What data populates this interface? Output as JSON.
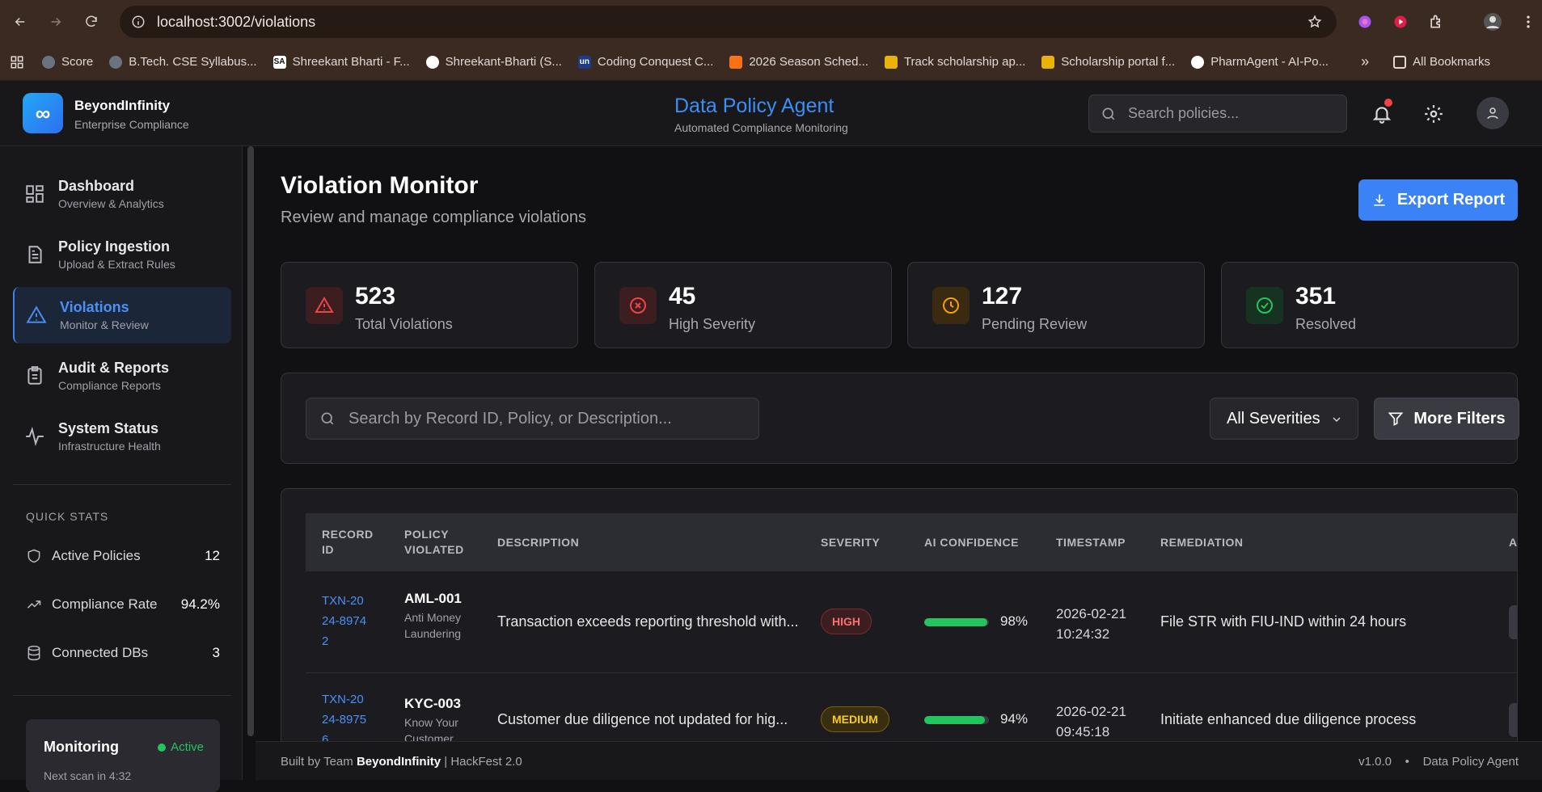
{
  "browser": {
    "url": "localhost:3002/violations",
    "bookmarks": [
      {
        "label": "Score",
        "icon": "globe-icon"
      },
      {
        "label": "B.Tech. CSE Syllabus...",
        "icon": "globe-icon"
      },
      {
        "label": "Shreekant Bharti - F...",
        "icon": "sa-icon"
      },
      {
        "label": "Shreekant-Bharti (S...",
        "icon": "github-icon"
      },
      {
        "label": "Coding Conquest C...",
        "icon": "un-icon"
      },
      {
        "label": "2026 Season Sched...",
        "icon": "ticket-icon"
      },
      {
        "label": "Track scholarship ap...",
        "icon": "scholar-icon"
      },
      {
        "label": "Scholarship portal f...",
        "icon": "scholar-icon"
      },
      {
        "label": "PharmAgent - AI-Po...",
        "icon": "pharm-icon"
      }
    ],
    "all_bookmarks": "All Bookmarks"
  },
  "header": {
    "brand_name": "BeyondInfinity",
    "brand_sub": "Enterprise Compliance",
    "logo_glyph": "∞",
    "title": "Data Policy Agent",
    "subtitle": "Automated Compliance Monitoring",
    "search_placeholder": "Search policies..."
  },
  "sidebar": {
    "items": [
      {
        "label": "Dashboard",
        "sub": "Overview & Analytics"
      },
      {
        "label": "Policy Ingestion",
        "sub": "Upload & Extract Rules"
      },
      {
        "label": "Violations",
        "sub": "Monitor & Review"
      },
      {
        "label": "Audit & Reports",
        "sub": "Compliance Reports"
      },
      {
        "label": "System Status",
        "sub": "Infrastructure Health"
      }
    ],
    "quick_stats_title": "QUICK STATS",
    "quick_stats": [
      {
        "label": "Active Policies",
        "value": "12"
      },
      {
        "label": "Compliance Rate",
        "value": "94.2%"
      },
      {
        "label": "Connected DBs",
        "value": "3"
      }
    ],
    "monitoring": {
      "title": "Monitoring",
      "status": "Active",
      "next": "Next scan in 4:32"
    }
  },
  "main": {
    "title": "Violation Monitor",
    "subtitle": "Review and manage compliance violations",
    "export_label": "Export Report",
    "stats": [
      {
        "value": "523",
        "label": "Total Violations",
        "color": "#ef4444"
      },
      {
        "value": "45",
        "label": "High Severity",
        "color": "#ef4444"
      },
      {
        "value": "127",
        "label": "Pending Review",
        "color": "#f59e0b"
      },
      {
        "value": "351",
        "label": "Resolved",
        "color": "#22c55e"
      }
    ],
    "filter_placeholder": "Search by Record ID, Policy, or Description...",
    "severity_select": "All Severities",
    "more_filters": "More Filters",
    "columns": [
      "RECORD ID",
      "POLICY VIOLATED",
      "DESCRIPTION",
      "SEVERITY",
      "AI CONFIDENCE",
      "TIMESTAMP",
      "REMEDIATION",
      "A"
    ],
    "rows": [
      {
        "record_id": "TXN-2024-89742",
        "policy_code": "AML-001",
        "policy_name": "Anti Money Laundering",
        "description": "Transaction exceeds reporting threshold with...",
        "severity": "HIGH",
        "confidence": 98,
        "confidence_text": "98%",
        "timestamp": "2026-02-21 10:24:32",
        "remediation": "File STR with FIU-IND within 24 hours"
      },
      {
        "record_id": "TXN-2024-89756",
        "policy_code": "KYC-003",
        "policy_name": "Know Your Customer",
        "description": "Customer due diligence not updated for hig...",
        "severity": "MEDIUM",
        "confidence": 94,
        "confidence_text": "94%",
        "timestamp": "2026-02-21 09:45:18",
        "remediation": "Initiate enhanced due diligence process"
      }
    ]
  },
  "footer": {
    "prefix": "Built by Team",
    "team": "BeyondInfinity",
    "suffix": "| HackFest 2.0",
    "version": "v1.0.0",
    "bullet": "•",
    "product": "Data Policy Agent"
  }
}
